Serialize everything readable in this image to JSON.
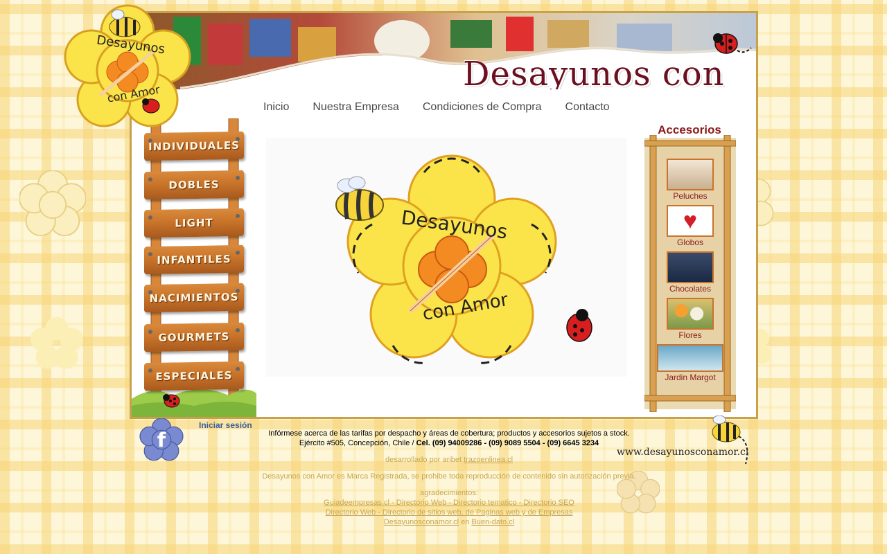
{
  "site": {
    "brand_title": "Desayunos con Amor",
    "logo_text_top": "Desayunos",
    "logo_text_bottom": "con Amor"
  },
  "nav": {
    "items": [
      {
        "label": "Inicio"
      },
      {
        "label": "Nuestra Empresa"
      },
      {
        "label": "Condiciones de Compra"
      },
      {
        "label": "Contacto"
      }
    ]
  },
  "ladder": {
    "items": [
      {
        "label": "INDIVIDUALES"
      },
      {
        "label": "DOBLES"
      },
      {
        "label": "LIGHT"
      },
      {
        "label": "INFANTILES"
      },
      {
        "label": "NACIMIENTOS"
      },
      {
        "label": "GOURMETS"
      },
      {
        "label": "ESPECIALES"
      }
    ]
  },
  "accessories": {
    "title": "Accesorios",
    "items": [
      {
        "label": "Peluches",
        "icon": "plush-dog-icon"
      },
      {
        "label": "Globos",
        "icon": "heart-balloon-icon"
      },
      {
        "label": "Chocolates",
        "icon": "chocolate-box-icon"
      },
      {
        "label": "Flores",
        "icon": "flowers-icon"
      },
      {
        "label": "Jardin Margot",
        "icon": "jardin-margot-logo"
      }
    ]
  },
  "footer": {
    "login_label": "Iniciar sesión",
    "info_line1": "Infórmese acerca de las tarifas por despacho y áreas de cobertura; productos y accesorios sujetos a stock.",
    "info_line2_prefix": "Ejército #505, Concepción, Chile / ",
    "info_line2_phones": "Cel. (09) 94009286 - (09) 9089 5504 - (09) 6645 3234",
    "dev_prefix": "desarrollado por aribet ",
    "dev_link": "trazoenlinea.cl",
    "trademark": "Desayunos con Amor es Marca Registrada, se prohibe toda reproducción de contenido sin autorización previa.",
    "thanks_label": "agradecimientos:",
    "thanks_link1": "Guiadeempresas.cl - Directorio Web - Directorio tematico - Directorio SEO",
    "thanks_link2": "Directorio Web - Directorio de sitios web, de Paginas web y de Empresas",
    "thanks_link3a": "Desayunosconamor.cl",
    "thanks_link3_mid": " en ",
    "thanks_link3b": "Buen-dato.cl",
    "website_text": "www.desayunosconamor.cl"
  },
  "colors": {
    "frame_border": "#c8a24a",
    "brand_red": "#6b1020",
    "accessory_red": "#8b1a1a",
    "wood": "#c9742a",
    "logo_yellow": "#fbe44a"
  }
}
